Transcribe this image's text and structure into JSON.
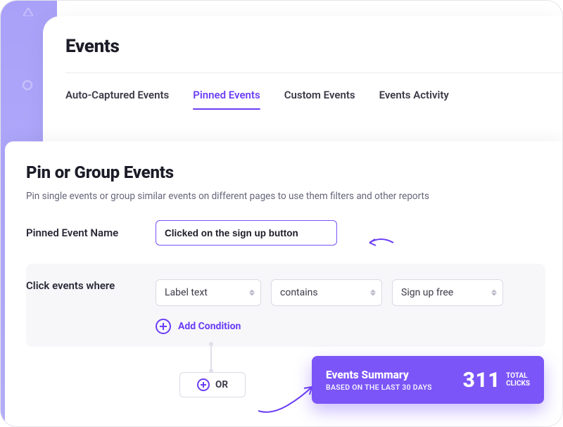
{
  "page": {
    "title": "Events"
  },
  "tabs": {
    "auto": "Auto-Captured Events",
    "pinned": "Pinned Events",
    "custom": "Custom Events",
    "activity": "Events Activity"
  },
  "panel": {
    "title": "Pin or Group Events",
    "subtitle": "Pin single events or group similar events on different pages to use them filters and other reports"
  },
  "form": {
    "name_label": "Pinned Event Name",
    "name_value": "Clicked on the sign up button",
    "condition_label": "Click events where",
    "select_attr": "Label text",
    "select_op": "contains",
    "select_val": "Sign up free",
    "add_condition": "Add Condition",
    "or_label": "OR"
  },
  "summary": {
    "title": "Events Summary",
    "subtitle": "BASED ON THE LAST 30 DAYS",
    "count": "311",
    "metric_l1": "TOTAL",
    "metric_l2": "CLICKS"
  }
}
